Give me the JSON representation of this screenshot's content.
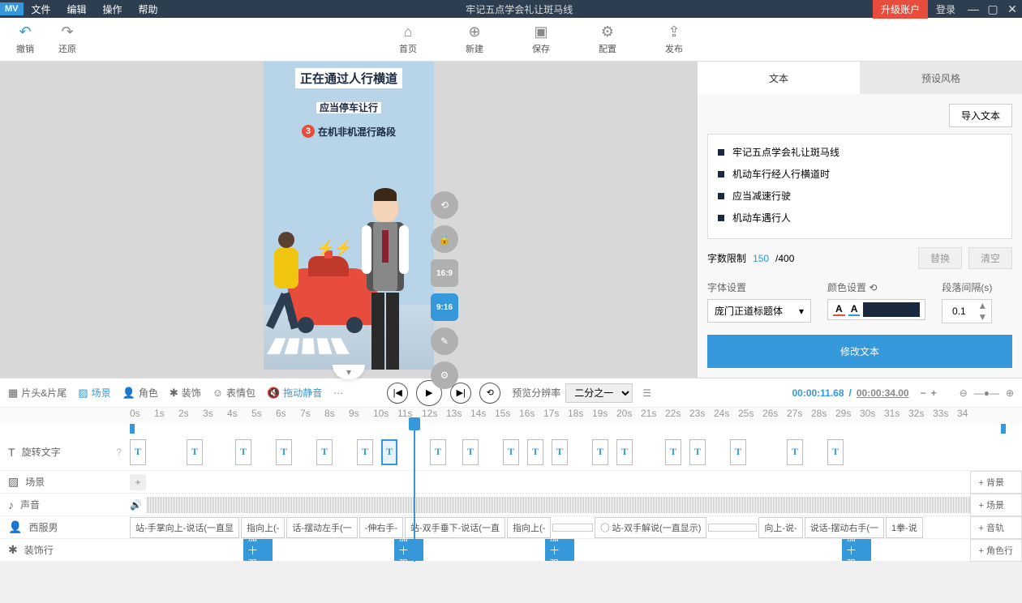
{
  "titlebar": {
    "logo": "MV",
    "menu": [
      "文件",
      "编辑",
      "操作",
      "帮助"
    ],
    "title": "牢记五点学会礼让斑马线",
    "upgrade": "升级账户",
    "login": "登录"
  },
  "toolbar": {
    "undo": "撤销",
    "redo": "还原",
    "home": "首页",
    "new": "新建",
    "save": "保存",
    "config": "配置",
    "publish": "发布"
  },
  "canvas": {
    "line1": "正在通过人行横道",
    "line2": "应当停车让行",
    "sub_num": "3",
    "sub_txt": "在机非机混行路段",
    "ratios": [
      "16:9",
      "9:16"
    ]
  },
  "right": {
    "tabs": [
      "文本",
      "预设风格"
    ],
    "import": "导入文本",
    "items": [
      "牢记五点学会礼让斑马线",
      "机动车行经人行横道时",
      "应当减速行驶",
      "机动车遇行人"
    ],
    "limit_label": "字数限制",
    "limit_cur": "150",
    "limit_max": "/400",
    "replace": "替换",
    "clear": "清空",
    "font_label": "字体设置",
    "font_value": "庞门正道标题体",
    "color_label": "颜色设置",
    "gap_label": "段落间隔(s)",
    "gap_value": "0.1",
    "modify": "修改文本"
  },
  "timeline": {
    "tabs": {
      "head": "片头&片尾",
      "scene": "场景",
      "role": "角色",
      "deco": "装饰",
      "emoji": "表情包",
      "mute": "拖动静音"
    },
    "preview_label": "预览分辨率",
    "preview_value": "二分之一",
    "time_cur": "00:00:11.68",
    "time_sep": "/",
    "time_total": "00:00:34.00",
    "ruler": [
      "0s",
      "1s",
      "2s",
      "3s",
      "4s",
      "5s",
      "6s",
      "7s",
      "8s",
      "9s",
      "10s",
      "11s",
      "12s",
      "13s",
      "14s",
      "15s",
      "16s",
      "17s",
      "18s",
      "19s",
      "20s",
      "21s",
      "22s",
      "23s",
      "24s",
      "25s",
      "26s",
      "27s",
      "28s",
      "29s",
      "30s",
      "31s",
      "32s",
      "33s",
      "34"
    ],
    "tracks": {
      "text": "旋转文字",
      "scene": "场景",
      "sound": "声音",
      "man": "西服男",
      "deco": "装饰行"
    },
    "actions": [
      "站-手掌向上-说话(一直显",
      "指向上(-",
      "话-摆动左手(一",
      "-伸右手-",
      "站-双手垂下-说话(一直",
      "指向上(-",
      "",
      "◯ 站-双手解说(一直显示)",
      "",
      "向上-说-",
      "说话-摆动右手(一",
      "1拳-说"
    ],
    "blue": "加 十 强",
    "side": [
      "+ 背景",
      "+ 场景",
      "+ 音轨",
      "+ 角色行"
    ]
  }
}
